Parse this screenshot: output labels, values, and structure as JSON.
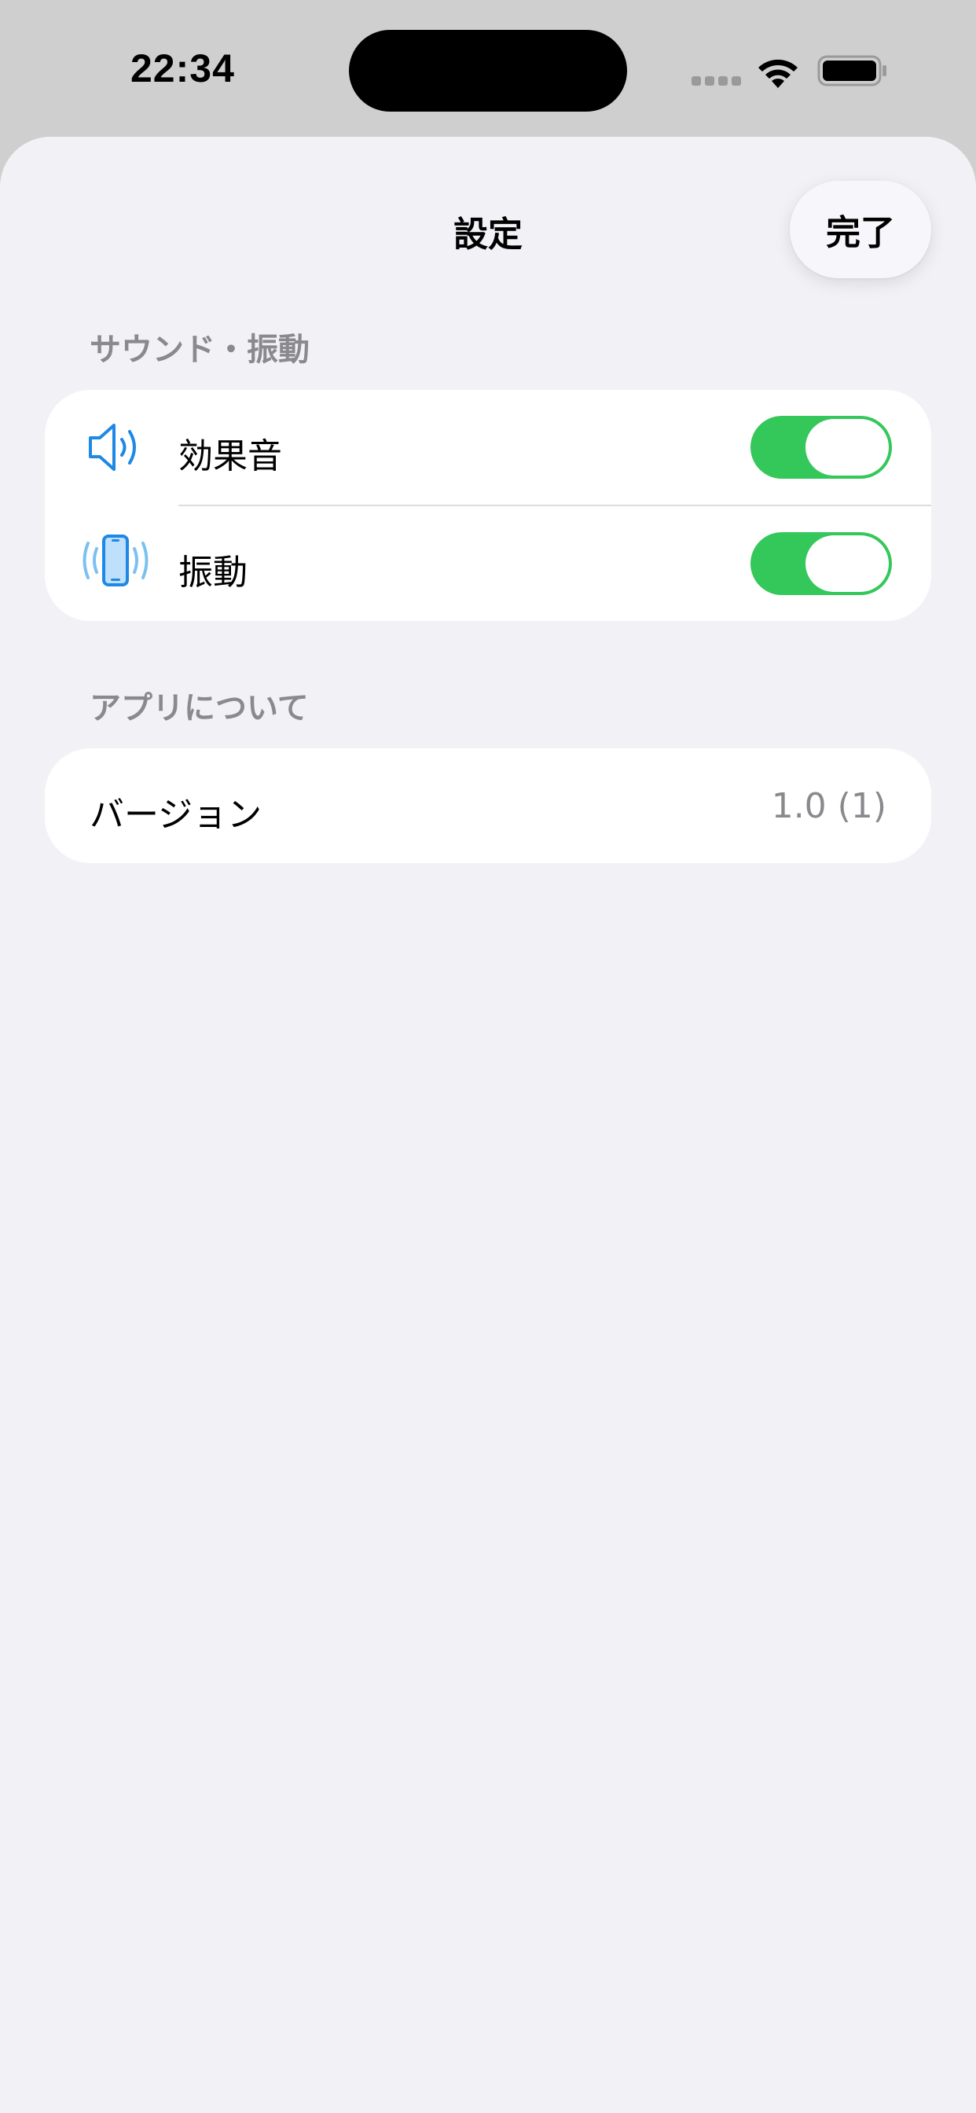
{
  "status_bar": {
    "time": "22:34",
    "icons": [
      "cellular-signal-icon",
      "wifi-icon",
      "battery-icon"
    ]
  },
  "nav": {
    "title": "設定",
    "done_label": "完了"
  },
  "sections": [
    {
      "header": "サウンド・振動",
      "rows": [
        {
          "label": "効果音",
          "icon": "speaker-icon",
          "toggle_on": true
        },
        {
          "label": "振動",
          "icon": "phone-vibration-icon",
          "toggle_on": true
        }
      ]
    },
    {
      "header": "アプリについて",
      "rows": [
        {
          "label": "バージョン",
          "value": "1.0 (1)"
        }
      ]
    }
  ],
  "colors": {
    "toggle_on": "#34c759",
    "accent_icon": "#1e88e5",
    "background": "#f2f1f6",
    "secondary_text": "#8a8a8e"
  }
}
